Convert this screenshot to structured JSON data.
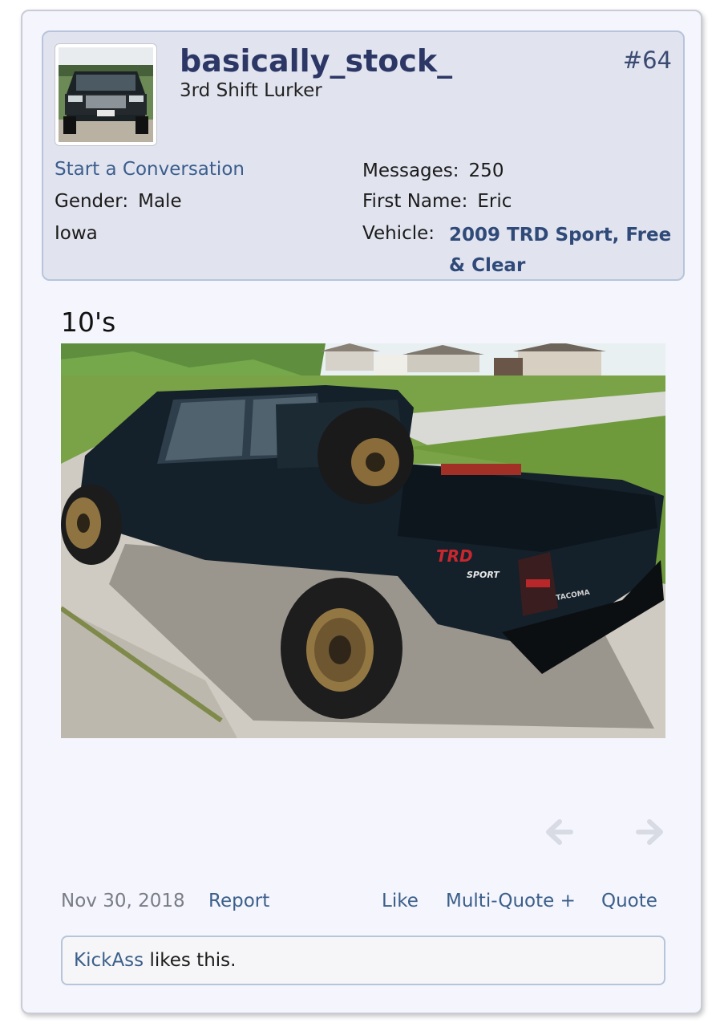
{
  "post": {
    "number": "#64",
    "text": "10's",
    "date": "Nov 30, 2018"
  },
  "user": {
    "username": "basically_stock_",
    "title": "3rd Shift Lurker",
    "start_conversation": "Start a Conversation",
    "gender_label": "Gender:",
    "gender": "Male",
    "location": "Iowa",
    "messages_label": "Messages:",
    "messages": "250",
    "first_name_label": "First Name:",
    "first_name": "Eric",
    "vehicle_label": "Vehicle:",
    "vehicle": "2009 TRD Sport, Free & Clear"
  },
  "actions": {
    "report": "Report",
    "like": "Like",
    "multi_quote": "Multi-Quote +",
    "quote": "Quote"
  },
  "likes": {
    "liker": "KickAss",
    "suffix": " likes this."
  },
  "image_text": {
    "decal_brand": "TRD",
    "decal_model": "SPORT",
    "tailgate_badge": "TACOMA"
  },
  "icons": {
    "prev": "arrow-left-icon",
    "next": "arrow-right-icon"
  },
  "colors": {
    "username": "#2c3766",
    "link": "#3b5f8a",
    "panel_bg": "#e1e4ef",
    "card_bg": "#f4f5fd"
  }
}
